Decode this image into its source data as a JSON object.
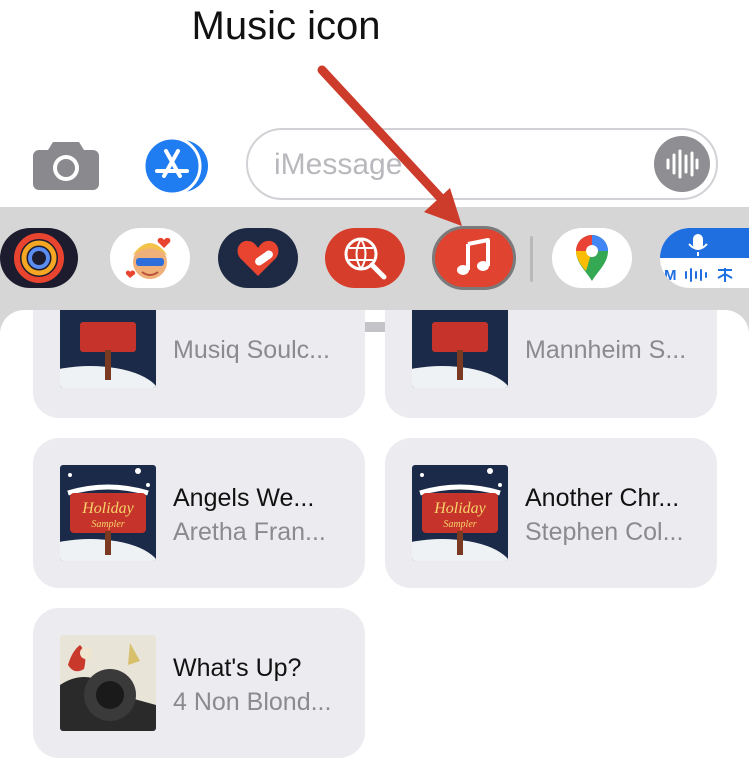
{
  "annotation": {
    "title": "Music icon"
  },
  "compose": {
    "camera_icon": "camera-icon",
    "appstore_icon": "app-store-icon",
    "message_placeholder": "iMessage",
    "audio_icon": "waveform-icon"
  },
  "drawer": {
    "apps": [
      {
        "name": "fitness-activity",
        "icon": "activity-rings-icon",
        "bg": "#1c1c2e"
      },
      {
        "name": "memoji",
        "icon": "memoji-sticker-icon",
        "bg": "#ffffff"
      },
      {
        "name": "heart-app",
        "icon": "heart-bandage-icon",
        "bg": "#1e2a44"
      },
      {
        "name": "search-images",
        "icon": "globe-search-icon",
        "bg": "#d63d2a"
      },
      {
        "name": "music",
        "icon": "music-note-icon",
        "bg": "#e0432f"
      },
      {
        "name": "google-maps",
        "icon": "maps-pin-icon",
        "bg": "#ffffff"
      },
      {
        "name": "voice-dictation",
        "icon": "microphone-icon",
        "bg": "#ffffff",
        "label": "M"
      }
    ]
  },
  "songs": [
    {
      "title": "",
      "artist": "Musiq Soulc...",
      "art": "holiday-sampler-art"
    },
    {
      "title": "",
      "artist": "Mannheim S...",
      "art": "holiday-sampler-art"
    },
    {
      "title": "Angels We...",
      "artist": "Aretha Fran...",
      "art": "holiday-sampler-art"
    },
    {
      "title": "Another Chr...",
      "artist": "Stephen Col...",
      "art": "holiday-sampler-art"
    },
    {
      "title": "What's Up?",
      "artist": "4 Non Blond...",
      "art": "bigger-better-faster-art"
    }
  ],
  "colors": {
    "accent_red": "#cf3a2c",
    "app_store_blue": "#1f7cf1",
    "drawer_bg": "#d6d6d6"
  }
}
